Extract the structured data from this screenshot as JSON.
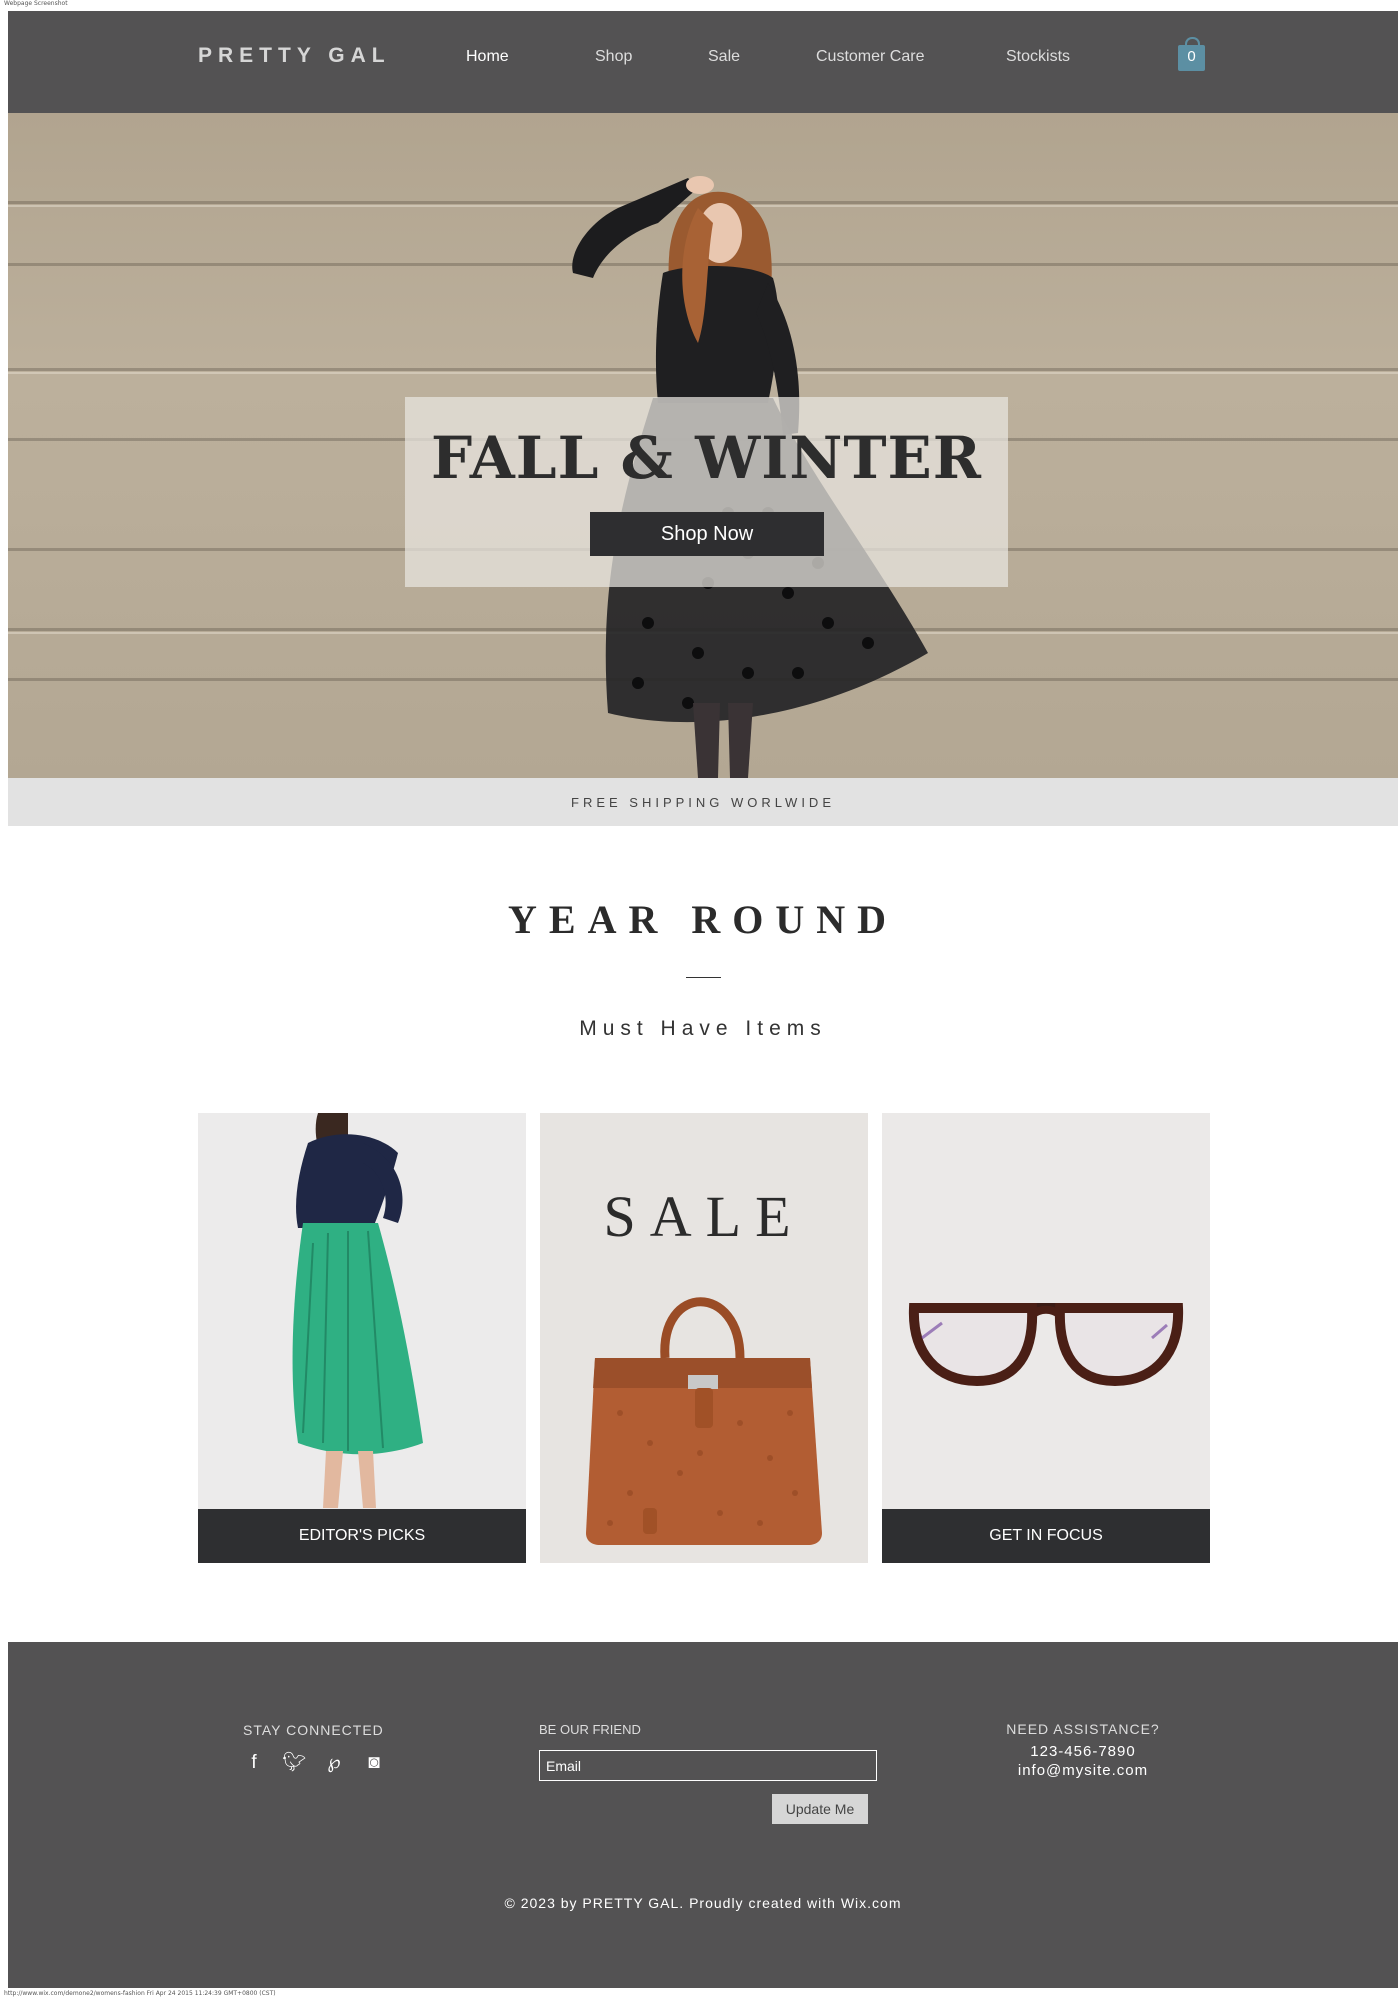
{
  "page": {
    "caption": "Webpage Screenshot",
    "url_stamp": "http://www.wix.com/demone2/womens-fashion Fri Apr 24 2015 11:24:39 GMT+0800 (CST)"
  },
  "header": {
    "logo": "PRETTY GAL",
    "nav": [
      "Home",
      "Shop",
      "Sale",
      "Customer Care",
      "Stockists"
    ],
    "active": "Home",
    "cart_count": "0",
    "cart_icon": "shopping-bag-icon"
  },
  "hero": {
    "title": "FALL & WINTER",
    "cta": "Shop Now"
  },
  "shipping": {
    "text": "FREE SHIPPING WORLWIDE"
  },
  "section": {
    "title": "YEAR ROUND",
    "subtitle": "Must Have Items"
  },
  "cards": [
    {
      "label": "EDITOR'S PICKS",
      "image": "woman-green-skirt-photo"
    },
    {
      "label": "SALE",
      "image": "leather-handbag-photo"
    },
    {
      "label": "GET IN FOCUS",
      "image": "eyeglasses-photo"
    }
  ],
  "footer": {
    "stay_connected": "STAY CONNECTED",
    "social": [
      "facebook-icon",
      "twitter-icon",
      "pinterest-icon",
      "instagram-icon"
    ],
    "be_friend": "BE OUR FRIEND",
    "email_placeholder": "Email",
    "update_button": "Update Me",
    "assist_title": "NEED ASSISTANCE?",
    "phone": "123-456-7890",
    "email": "info@mysite.com",
    "copyright": "© 2023 by PRETTY GAL. Proudly created with Wix.com"
  },
  "colors": {
    "header_bg": "#535253",
    "cart_accent": "#5c8fa3",
    "dark_button": "#2e2f31",
    "shipping_bar": "#e2e2e2"
  }
}
